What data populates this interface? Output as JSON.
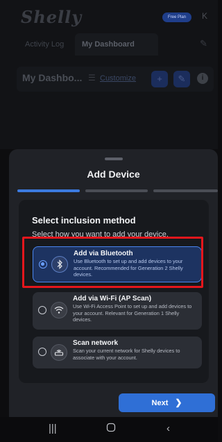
{
  "app": {
    "logo_text": "Shelly",
    "plan_badge": "Free Plan",
    "avatar_initial": "K",
    "tabs": [
      {
        "label": "Activity Log"
      },
      {
        "label": "My Dashboard"
      }
    ],
    "dashboard_title": "My Dashbo...",
    "customize_label": "Customize",
    "add_icon": "plus-icon",
    "edit_icon": "pencil-icon",
    "info_icon": "info-icon"
  },
  "sheet": {
    "title": "Add Device",
    "steps_total": 3,
    "steps_active": 1,
    "card_title": "Select inclusion method",
    "card_subtitle": "Select how you want to add your device.",
    "options": [
      {
        "title": "Add via Bluetooth",
        "description": "Use Bluetooth to set up and add devices to your account. Recommended for Generation 2 Shelly devices.",
        "icon": "bluetooth-icon",
        "selected": true
      },
      {
        "title": "Add via Wi-Fi (AP Scan)",
        "description": "Use Wi-Fi Access Point to set up and add devices to your account. Relevant for Generation 1 Shelly devices.",
        "icon": "wifi-icon",
        "selected": false
      },
      {
        "title": "Scan network",
        "description": "Scan your current network for Shelly devices to associate with your account.",
        "icon": "router-icon",
        "selected": false
      }
    ],
    "next_label": "Next",
    "next_icon": "chevron-right-icon"
  },
  "colors": {
    "accent": "#3c7be0",
    "highlight_box": "#e5161c",
    "sheet_bg": "#202227"
  },
  "navbar": {
    "recents_icon": "recents-icon",
    "home_icon": "home-icon",
    "back_icon": "back-icon"
  }
}
